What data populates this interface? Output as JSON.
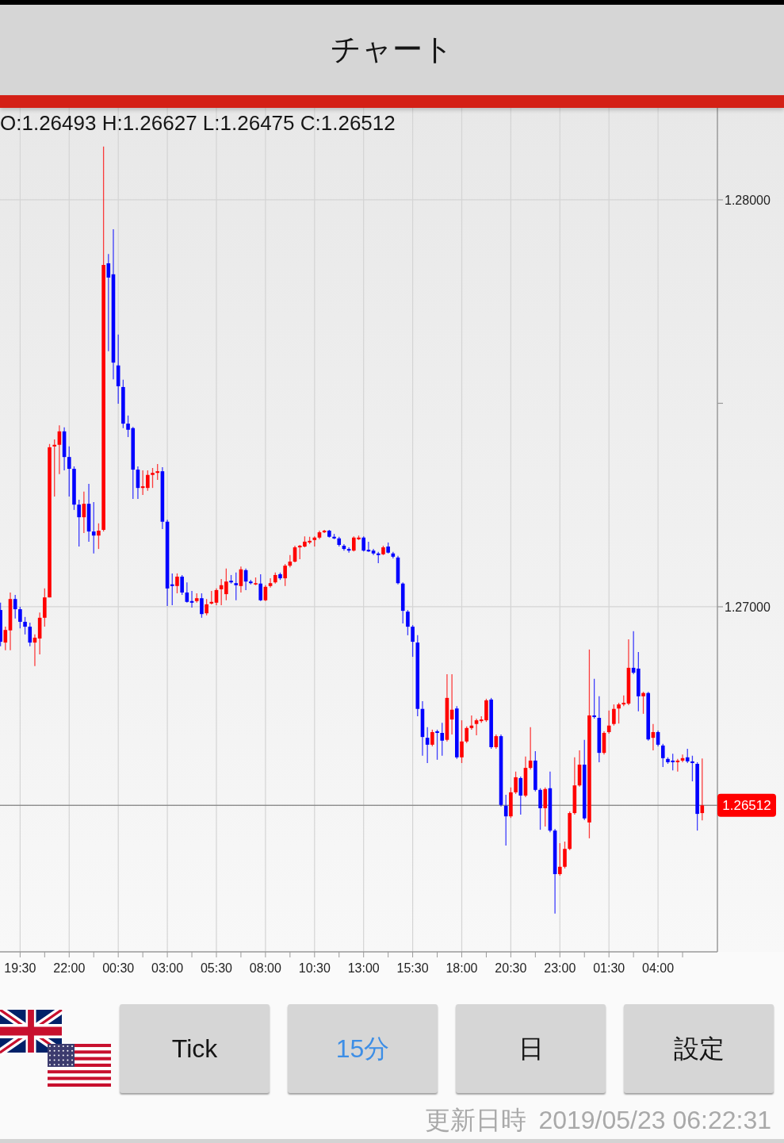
{
  "title_bar": {
    "title": "チャート"
  },
  "chart": {
    "ohlc_readout": "O:1.26493 H:1.26627 L:1.26475 C:1.26512",
    "chart_data": {
      "type": "candlestick",
      "categories": [
        null,
        null,
        null,
        null,
        "19:30",
        null,
        null,
        null,
        null,
        null,
        null,
        null,
        null,
        null,
        "22:00",
        null,
        null,
        null,
        null,
        null,
        null,
        null,
        null,
        null,
        "00:30",
        null,
        null,
        null,
        null,
        null,
        null,
        null,
        null,
        null,
        "03:00",
        null,
        null,
        null,
        null,
        null,
        null,
        null,
        null,
        null,
        "05:30",
        null,
        null,
        null,
        null,
        null,
        null,
        null,
        null,
        null,
        "08:00",
        null,
        null,
        null,
        null,
        null,
        null,
        null,
        null,
        null,
        "10:30",
        null,
        null,
        null,
        null,
        null,
        null,
        null,
        null,
        null,
        "13:00",
        null,
        null,
        null,
        null,
        null,
        null,
        null,
        null,
        null,
        "15:30",
        null,
        null,
        null,
        null,
        null,
        null,
        null,
        null,
        null,
        "18:00",
        null,
        null,
        null,
        null,
        null,
        null,
        null,
        null,
        null,
        "20:30",
        null,
        null,
        null,
        null,
        null,
        null,
        null,
        null,
        null,
        "23:00",
        null,
        null,
        null,
        null,
        null,
        null,
        null,
        null,
        null,
        "01:30",
        null,
        null,
        null,
        null,
        null,
        null,
        null,
        null,
        null,
        "04:00",
        null,
        null,
        null,
        null,
        null,
        null,
        null,
        null,
        null
      ],
      "ohlc": [
        [
          1.26992,
          1.2701,
          1.26903,
          1.26914
        ],
        [
          1.26912,
          1.26951,
          1.26893,
          1.26943
        ],
        [
          1.26942,
          1.27035,
          1.26893,
          1.27019
        ],
        [
          1.27019,
          1.27029,
          1.26971,
          1.26994
        ],
        [
          1.26994,
          1.27,
          1.26947,
          1.26963
        ],
        [
          1.26963,
          1.26975,
          1.26932,
          1.26951
        ],
        [
          1.26951,
          1.26961,
          1.26903,
          1.26912
        ],
        [
          1.26912,
          1.26932,
          1.26854,
          1.26924
        ],
        [
          1.26922,
          1.26986,
          1.26883,
          1.26973
        ],
        [
          1.26973,
          1.27045,
          1.26951,
          1.27023
        ],
        [
          1.27023,
          1.274,
          1.27023,
          1.27392
        ],
        [
          1.27394,
          1.27411,
          1.27271,
          1.27398
        ],
        [
          1.27398,
          1.27446,
          1.27326,
          1.27431
        ],
        [
          1.27431,
          1.27441,
          1.27335,
          1.27368
        ],
        [
          1.27368,
          1.27394,
          1.27271,
          1.27339
        ],
        [
          1.27339,
          1.27345,
          1.27238,
          1.27251
        ],
        [
          1.27251,
          1.27263,
          1.27148,
          1.2722
        ],
        [
          1.2722,
          1.27283,
          1.27181,
          1.27253
        ],
        [
          1.27253,
          1.27302,
          1.2716,
          1.27185
        ],
        [
          1.27185,
          1.27257,
          1.27131,
          1.27175
        ],
        [
          1.27175,
          1.27205,
          1.27142,
          1.27187
        ],
        [
          1.27189,
          1.28131,
          1.27185,
          1.2784
        ],
        [
          1.27844,
          1.27867,
          1.27628,
          1.27809
        ],
        [
          1.27817,
          1.27928,
          1.27559,
          1.276
        ],
        [
          1.27593,
          1.27669,
          1.27499,
          1.27542
        ],
        [
          1.2754,
          1.27558,
          1.27439,
          1.2745
        ],
        [
          1.2745,
          1.2747,
          1.27417,
          1.27435
        ],
        [
          1.27439,
          1.27442,
          1.27265,
          1.27337
        ],
        [
          1.27337,
          1.27345,
          1.27265,
          1.27292
        ],
        [
          1.27292,
          1.27335,
          1.27275,
          1.27296
        ],
        [
          1.27292,
          1.27335,
          1.27285,
          1.27324
        ],
        [
          1.27324,
          1.27341,
          1.27292,
          1.27329
        ],
        [
          1.27329,
          1.27351,
          1.27312,
          1.27333
        ],
        [
          1.27333,
          1.27343,
          1.27191,
          1.27209
        ],
        [
          1.27209,
          1.27214,
          1.27002,
          1.27045
        ],
        [
          1.27055,
          1.27082,
          1.27004,
          1.27051
        ],
        [
          1.27051,
          1.27082,
          1.27033,
          1.27074
        ],
        [
          1.27074,
          1.27078,
          1.27029,
          1.27035
        ],
        [
          1.27035,
          1.2706,
          1.2701,
          1.27012
        ],
        [
          1.27014,
          1.27039,
          1.26998,
          1.2701
        ],
        [
          1.27014,
          1.27033,
          1.2701,
          1.27021
        ],
        [
          1.27021,
          1.27033,
          1.26973,
          1.26982
        ],
        [
          1.26984,
          1.27019,
          1.26979,
          1.27006
        ],
        [
          1.27008,
          1.27039,
          1.27006,
          1.27012
        ],
        [
          1.2701,
          1.27045,
          1.27004,
          1.27041
        ],
        [
          1.27043,
          1.27068,
          1.27004,
          1.27053
        ],
        [
          1.27031,
          1.27094,
          1.27016,
          1.27062
        ],
        [
          1.27064,
          1.27078,
          1.27057,
          1.2706
        ],
        [
          1.27058,
          1.27084,
          1.27016,
          1.27053
        ],
        [
          1.27051,
          1.27099,
          1.27035,
          1.27092
        ],
        [
          1.2709,
          1.27094,
          1.27041,
          1.27062
        ],
        [
          1.27062,
          1.27066,
          1.27055,
          1.27058
        ],
        [
          1.27055,
          1.27072,
          1.27053,
          1.27058
        ],
        [
          1.27057,
          1.2708,
          1.27014,
          1.27016
        ],
        [
          1.27016,
          1.27053,
          1.27014,
          1.27049
        ],
        [
          1.27051,
          1.2707,
          1.27047,
          1.27058
        ],
        [
          1.2706,
          1.27084,
          1.27057,
          1.27078
        ],
        [
          1.2708,
          1.27084,
          1.27066,
          1.2707
        ],
        [
          1.2707,
          1.27105,
          1.27051,
          1.27101
        ],
        [
          1.27101,
          1.27127,
          1.27097,
          1.27111
        ],
        [
          1.27111,
          1.2715,
          1.27109,
          1.27146
        ],
        [
          1.27146,
          1.27152,
          1.27117,
          1.2715
        ],
        [
          1.27148,
          1.27173,
          1.27146,
          1.2716
        ],
        [
          1.27158,
          1.27172,
          1.27154,
          1.27162
        ],
        [
          1.27164,
          1.27173,
          1.27148,
          1.2717
        ],
        [
          1.2717,
          1.27187,
          1.27166,
          1.27183
        ],
        [
          1.27183,
          1.27189,
          1.27181,
          1.27187
        ],
        [
          1.27187,
          1.27189,
          1.2717,
          1.27172
        ],
        [
          1.27172,
          1.27179,
          1.27166,
          1.27168
        ],
        [
          1.27168,
          1.27172,
          1.27148,
          1.27152
        ],
        [
          1.2715,
          1.27154,
          1.27138,
          1.27142
        ],
        [
          1.27142,
          1.27146,
          1.27133,
          1.27138
        ],
        [
          1.27138,
          1.27173,
          1.27136,
          1.2717
        ],
        [
          1.27166,
          1.27175,
          1.27164,
          1.2717
        ],
        [
          1.2717,
          1.27173,
          1.27136,
          1.27138
        ],
        [
          1.2714,
          1.2716,
          1.27135,
          1.27136
        ],
        [
          1.27138,
          1.27142,
          1.27127,
          1.27131
        ],
        [
          1.27131,
          1.27135,
          1.27107,
          1.27127
        ],
        [
          1.27129,
          1.2715,
          1.27127,
          1.27146
        ],
        [
          1.27148,
          1.27158,
          1.27131,
          1.27133
        ],
        [
          1.27131,
          1.27135,
          1.27119,
          1.27123
        ],
        [
          1.27121,
          1.27125,
          1.27055,
          1.27058
        ],
        [
          1.27057,
          1.2706,
          1.26959,
          1.2699
        ],
        [
          1.26988,
          1.26992,
          1.2693,
          1.26951
        ],
        [
          1.26951,
          1.26955,
          1.26877,
          1.26914
        ],
        [
          1.26912,
          1.2693,
          1.26731,
          1.26749
        ],
        [
          1.26749,
          1.26768,
          1.26634,
          1.2668
        ],
        [
          1.26678,
          1.26704,
          1.26616,
          1.26661
        ],
        [
          1.26661,
          1.26698,
          1.26657,
          1.26692
        ],
        [
          1.26694,
          1.26698,
          1.26624,
          1.2669
        ],
        [
          1.2669,
          1.26715,
          1.26634,
          1.26671
        ],
        [
          1.26673,
          1.26834,
          1.26669,
          1.26776
        ],
        [
          1.26723,
          1.26834,
          1.26686,
          1.26747
        ],
        [
          1.2675,
          1.26756,
          1.26626,
          1.2663
        ],
        [
          1.2663,
          1.26721,
          1.26616,
          1.26669
        ],
        [
          1.26669,
          1.26706,
          1.26665,
          1.26702
        ],
        [
          1.26702,
          1.26733,
          1.26698,
          1.26708
        ],
        [
          1.26712,
          1.26725,
          1.26684,
          1.26721
        ],
        [
          1.26719,
          1.26731,
          1.26715,
          1.26723
        ],
        [
          1.26721,
          1.26774,
          1.26717,
          1.2677
        ],
        [
          1.26772,
          1.26776,
          1.26651,
          1.26655
        ],
        [
          1.26655,
          1.26686,
          1.26651,
          1.26682
        ],
        [
          1.26682,
          1.26686,
          1.26509,
          1.26513
        ],
        [
          1.26511,
          1.26538,
          1.26413,
          1.26485
        ],
        [
          1.26485,
          1.26556,
          1.26481,
          1.26544
        ],
        [
          1.26544,
          1.26595,
          1.2654,
          1.26581
        ],
        [
          1.26579,
          1.26583,
          1.26489,
          1.26536
        ],
        [
          1.26536,
          1.26632,
          1.26532,
          1.26604
        ],
        [
          1.26604,
          1.26704,
          1.266,
          1.26622
        ],
        [
          1.26622,
          1.26645,
          1.26546,
          1.2655
        ],
        [
          1.2655,
          1.26554,
          1.26452,
          1.26505
        ],
        [
          1.26505,
          1.26556,
          1.2646,
          1.26552
        ],
        [
          1.26554,
          1.26595,
          1.26446,
          1.2645
        ],
        [
          1.2645,
          1.26454,
          1.26246,
          1.26343
        ],
        [
          1.26343,
          1.26419,
          1.26339,
          1.26361
        ],
        [
          1.26361,
          1.26423,
          1.26357,
          1.26405
        ],
        [
          1.26405,
          1.26497,
          1.26402,
          1.26493
        ],
        [
          1.26493,
          1.2663,
          1.26489,
          1.26561
        ],
        [
          1.26561,
          1.26647,
          1.26558,
          1.26612
        ],
        [
          1.26612,
          1.26673,
          1.26476,
          1.2648
        ],
        [
          1.2647,
          1.26895,
          1.26431,
          1.26733
        ],
        [
          1.26733,
          1.26823,
          1.26725,
          1.26729
        ],
        [
          1.26727,
          1.2678,
          1.26618,
          1.26641
        ],
        [
          1.26641,
          1.26694,
          1.26637,
          1.2669
        ],
        [
          1.26692,
          1.26745,
          1.26688,
          1.26708
        ],
        [
          1.26712,
          1.2676,
          1.26708,
          1.26749
        ],
        [
          1.2675,
          1.26764,
          1.26713,
          1.2676
        ],
        [
          1.2676,
          1.26782,
          1.26756,
          1.26764
        ],
        [
          1.26762,
          1.2692,
          1.26758,
          1.2685
        ],
        [
          1.2685,
          1.2694,
          1.26834,
          1.26838
        ],
        [
          1.26848,
          1.26889,
          1.26743,
          1.2678
        ],
        [
          1.2678,
          1.26791,
          1.26737,
          1.26788
        ],
        [
          1.26788,
          1.26791,
          1.26671,
          1.26674
        ],
        [
          1.26678,
          1.26712,
          1.26647,
          1.26692
        ],
        [
          1.26692,
          1.26696,
          1.26657,
          1.26661
        ],
        [
          1.26659,
          1.26663,
          1.26606,
          1.26628
        ],
        [
          1.26626,
          1.2663,
          1.26614,
          1.26618
        ],
        [
          1.26622,
          1.26639,
          1.26598,
          1.26618
        ],
        [
          1.26618,
          1.26626,
          1.26595,
          1.26622
        ],
        [
          1.26622,
          1.26637,
          1.26618,
          1.26628
        ],
        [
          1.2663,
          1.26651,
          1.26616,
          1.2662
        ],
        [
          1.2662,
          1.26634,
          1.26571,
          1.26616
        ],
        [
          1.26614,
          1.26618,
          1.2645,
          1.26491
        ],
        [
          1.26493,
          1.26627,
          1.26475,
          1.26512
        ]
      ],
      "ylim": [
        1.26152,
        1.28226
      ],
      "yticks": [
        {
          "value": 1.28,
          "label": "1.28000"
        },
        {
          "value": 1.27,
          "label": "1.27000"
        }
      ],
      "ref_lines": [
        {
          "axis": "y",
          "value": 1.26512,
          "label": "1.26512"
        }
      ]
    }
  },
  "period_buttons": [
    {
      "label": "Tick",
      "selected": false
    },
    {
      "label": "15分",
      "selected": true
    },
    {
      "label": "日",
      "selected": false
    }
  ],
  "settings_button": {
    "label": "設定"
  },
  "updated": {
    "label": "更新日時",
    "value": "2019/05/23 06:22:31"
  }
}
